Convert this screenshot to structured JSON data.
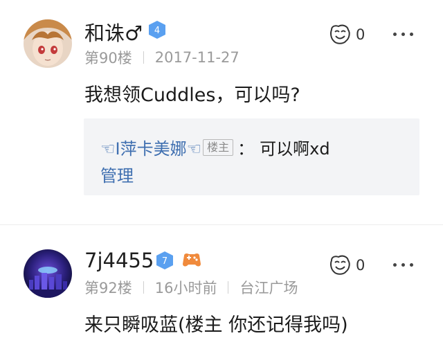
{
  "posts": [
    {
      "username": "和诛♂",
      "level": "4",
      "floor": "第90楼",
      "time": "2017-11-27",
      "likes": "0",
      "content": "我想领Cuddles，可以吗?",
      "reply": {
        "name": "☜I萍卡美娜☜",
        "host_tag": "楼主",
        "separator": "：",
        "text": "可以啊xd"
      },
      "manage_label": "管理"
    },
    {
      "username": "7j4455",
      "level": "7",
      "floor": "第92楼",
      "time": "16小时前",
      "location": "台江广场",
      "likes": "0",
      "content": "来只瞬吸蓝(楼主 你还记得我吗)"
    }
  ],
  "colors": {
    "link": "#3f6fb0",
    "badge_blue": "#5aa0f0",
    "badge_orange": "#f08a3c"
  },
  "icons": [
    "avatar",
    "level-badge-icon",
    "game-badge-icon",
    "like-face-icon",
    "more-icon"
  ]
}
